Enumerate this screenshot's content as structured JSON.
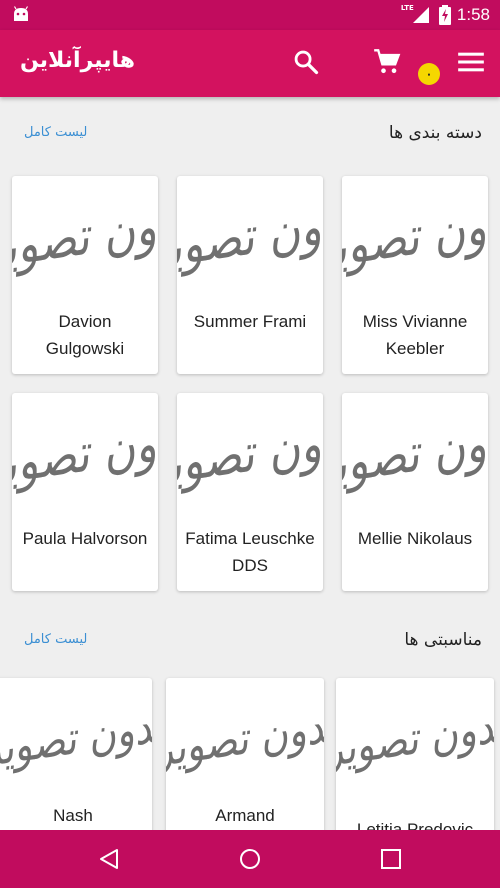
{
  "status": {
    "time": "1:58",
    "network": "LTE"
  },
  "app_bar": {
    "title": "هایپرآنلاین",
    "cart_count": "۰",
    "icons": [
      "search-icon",
      "cart-icon",
      "menu-icon"
    ]
  },
  "categories": {
    "title": "دسته بندی ها",
    "link": "لیست کامل",
    "items": [
      {
        "name": "Miss Vivianne Keebler",
        "image_text": "بدون تصویر"
      },
      {
        "name": "Summer Frami",
        "image_text": "بدون تصویر"
      },
      {
        "name": "Davion Gulgowski",
        "image_text": "بدون تصویر"
      },
      {
        "name": "Mellie Nikolaus",
        "image_text": "بدون تصویر"
      },
      {
        "name": "Fatima Leuschke DDS",
        "image_text": "بدون تصویر"
      },
      {
        "name": "Paula Halvorson",
        "image_text": "بدون تصویر"
      }
    ]
  },
  "occasions": {
    "title": "مناسبتی ها",
    "link": "لیست کامل",
    "items": [
      {
        "name": "Letitia Predovic",
        "image_text": "بدون تصویر"
      },
      {
        "name": "Armand",
        "image_text": "بدون تصویر"
      },
      {
        "name": "Nash",
        "image_text": "بدون تصویر"
      }
    ]
  },
  "colors": {
    "primary": "#d3125f",
    "primary_dark": "#c10c5e",
    "badge": "#f5d700",
    "link": "#3b8fd3"
  }
}
